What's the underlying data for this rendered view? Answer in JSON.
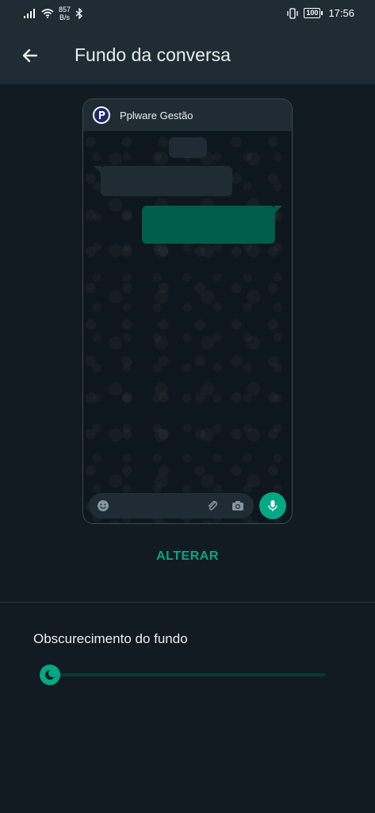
{
  "status_bar": {
    "net_speed": "857",
    "net_unit": "B/s",
    "battery": "100",
    "time": "17:56"
  },
  "app_bar": {
    "title": "Fundo da conversa",
    "back_icon": "arrow-left-icon"
  },
  "preview": {
    "contact_name": "Pplware Gestão",
    "icons": [
      "emoji-icon",
      "attach-icon",
      "camera-icon",
      "mic-icon"
    ]
  },
  "change_button": {
    "label": "ALTERAR"
  },
  "dimming": {
    "label": "Obscurecimento do fundo",
    "value": 0,
    "thumb_icon": "moon-icon"
  },
  "colors": {
    "accent": "#00a884",
    "background": "#121b22",
    "bar": "#1f2c34"
  }
}
